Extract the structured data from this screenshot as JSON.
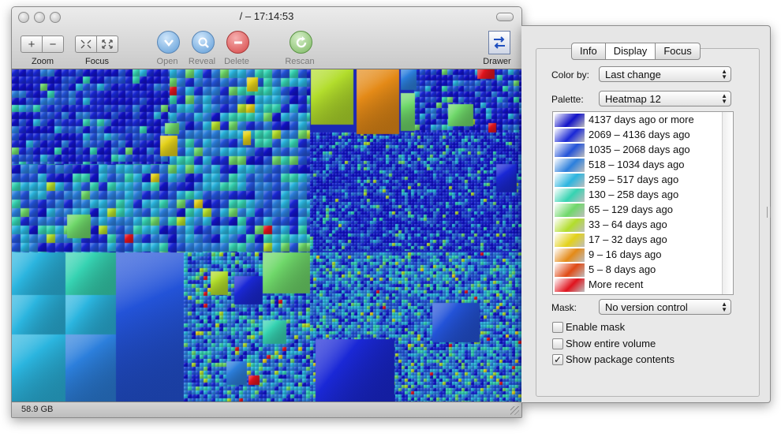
{
  "window": {
    "title": "/ – 17:14:53",
    "status_text": "58.9 GB"
  },
  "toolbar": {
    "zoom_label": "Zoom",
    "focus_label": "Focus",
    "open_label": "Open",
    "reveal_label": "Reveal",
    "delete_label": "Delete",
    "rescan_label": "Rescan",
    "drawer_label": "Drawer",
    "zoom_in_symbol": "+",
    "zoom_out_symbol": "−"
  },
  "drawer": {
    "tabs": [
      {
        "label": "Info",
        "selected": false
      },
      {
        "label": "Display",
        "selected": true
      },
      {
        "label": "Focus",
        "selected": false
      }
    ],
    "color_by_label": "Color by:",
    "color_by_value": "Last change",
    "palette_label": "Palette:",
    "palette_value": "Heatmap 12",
    "legend": [
      {
        "label": "4137 days ago or more",
        "color": "#1212c8"
      },
      {
        "label": "2069 – 4136 days ago",
        "color": "#1a28d6"
      },
      {
        "label": "1035 – 2068 days ago",
        "color": "#2353d8"
      },
      {
        "label": "518 – 1034 days ago",
        "color": "#2c7fdc"
      },
      {
        "label": "259 – 517 days ago",
        "color": "#2bb5df"
      },
      {
        "label": "130 – 258 days ago",
        "color": "#36d3b2"
      },
      {
        "label": "65 – 129 days ago",
        "color": "#6fd86a"
      },
      {
        "label": "33 – 64 days ago",
        "color": "#b2dd2c"
      },
      {
        "label": "17 – 32 days ago",
        "color": "#e3d11a"
      },
      {
        "label": "9 – 16 days ago",
        "color": "#e48a17"
      },
      {
        "label": "5 – 8 days ago",
        "color": "#e04a16"
      },
      {
        "label": "More recent",
        "color": "#e0141e"
      }
    ],
    "mask_label": "Mask:",
    "mask_value": "No version control",
    "checkboxes": [
      {
        "label": "Enable mask",
        "checked": false
      },
      {
        "label": "Show entire volume",
        "checked": false
      },
      {
        "label": "Show package contents",
        "checked": true
      }
    ]
  }
}
